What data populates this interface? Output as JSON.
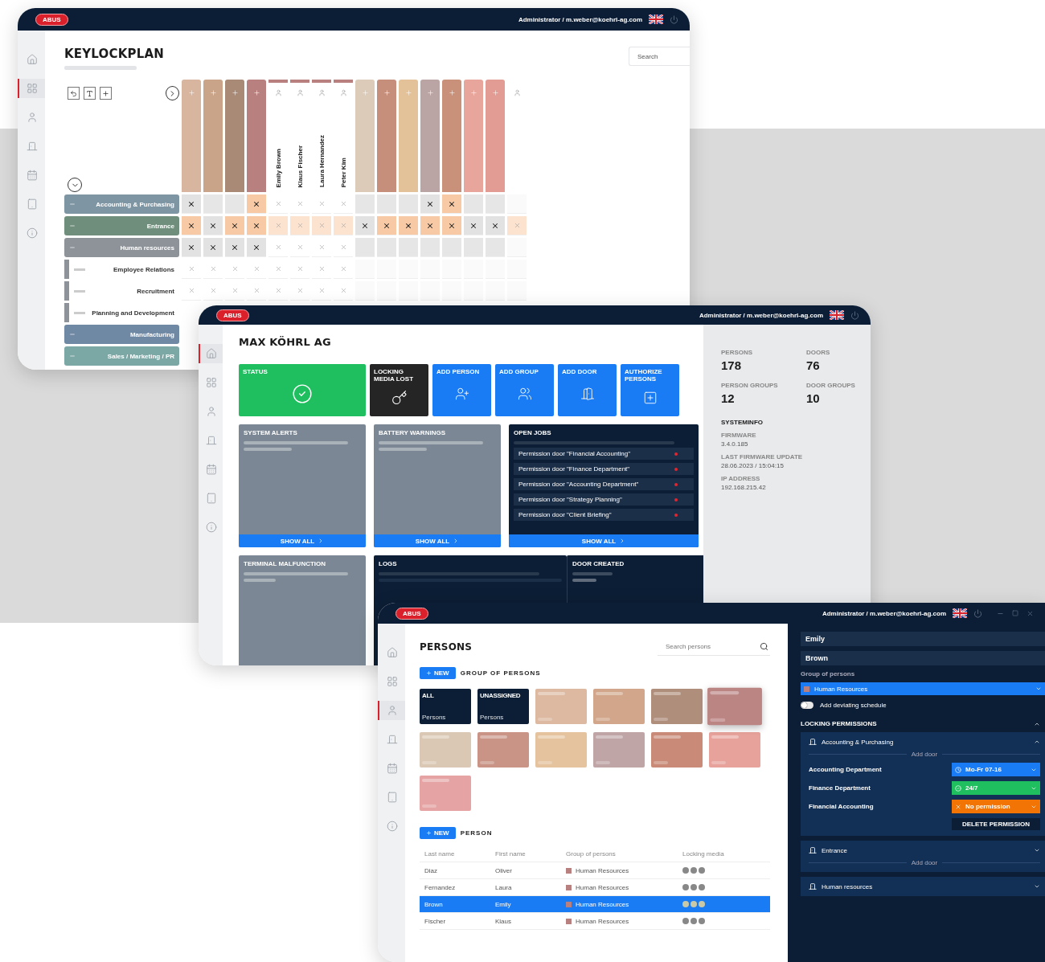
{
  "keylockplan_window": {
    "logo": "ABUS",
    "user": "Administrator / m.weber@koehrl-ag.com",
    "sidebar": [
      {
        "selected": false
      },
      {
        "selected": true
      },
      {
        "selected": false
      },
      {
        "selected": false
      },
      {
        "selected": false
      },
      {
        "selected": false
      },
      {
        "selected": false
      }
    ],
    "title": "KEYLOCKPLAN",
    "search": {
      "placeholder": "Search"
    },
    "columns": [
      {
        "kind": "group",
        "color": "#d8b59f"
      },
      {
        "kind": "group",
        "color": "#c9a488"
      },
      {
        "kind": "group",
        "color": "#a88a76"
      },
      {
        "kind": "group",
        "color": "#b8807f"
      },
      {
        "kind": "person",
        "label": "Emily Brown",
        "color": "#b8807f"
      },
      {
        "kind": "person",
        "label": "Klaus Fischer",
        "color": "#b8807f"
      },
      {
        "kind": "person",
        "label": "Laura Hernandez",
        "color": "#b8807f"
      },
      {
        "kind": "person",
        "label": "Peter Kim",
        "color": "#b8807f"
      },
      {
        "kind": "group",
        "color": "#dccbb8"
      },
      {
        "kind": "group",
        "color": "#c68f7c"
      },
      {
        "kind": "group",
        "color": "#e3c29a"
      },
      {
        "kind": "group",
        "color": "#bba4a4"
      },
      {
        "kind": "group",
        "color": "#c9907a"
      },
      {
        "kind": "group",
        "color": "#e8a59c"
      },
      {
        "kind": "group",
        "color": "#e29c94"
      },
      {
        "kind": "person",
        "color": "#ffffff"
      }
    ],
    "rows": [
      {
        "kind": "group",
        "label": "Accounting & Purchasing",
        "color": "#7e95a3",
        "cells": [
          {
            "crossed": true,
            "strong": true,
            "color": "#e2e2e2"
          },
          {
            "crossed": false,
            "color": "#e6e6e6"
          },
          {
            "crossed": false,
            "color": "#e6e6e6"
          },
          {
            "crossed": true,
            "strong": true,
            "color": "#f7c9a4"
          },
          {
            "crossed": true,
            "strong": false,
            "color": "#ffffff"
          },
          {
            "crossed": true,
            "strong": false,
            "color": "#ffffff"
          },
          {
            "crossed": true,
            "strong": false,
            "color": "#ffffff"
          },
          {
            "crossed": true,
            "strong": false,
            "color": "#ffffff"
          },
          {
            "crossed": false,
            "color": "#e6e6e6"
          },
          {
            "crossed": false,
            "color": "#e6e6e6"
          },
          {
            "crossed": false,
            "color": "#e6e6e6"
          },
          {
            "crossed": true,
            "strong": true,
            "color": "#e2e2e2"
          },
          {
            "crossed": true,
            "strong": true,
            "color": "#f7c9a4"
          },
          {
            "crossed": false,
            "color": "#e6e6e6"
          },
          {
            "crossed": false,
            "color": "#e6e6e6"
          },
          {
            "crossed": false,
            "color": "#fafafa"
          }
        ]
      },
      {
        "kind": "group",
        "label": "Entrance",
        "color": "#6f8f7c",
        "cells": [
          {
            "crossed": true,
            "strong": true,
            "color": "#f7c9a4"
          },
          {
            "crossed": true,
            "strong": true,
            "color": "#e2e2e2"
          },
          {
            "crossed": true,
            "strong": true,
            "color": "#f7c9a4"
          },
          {
            "crossed": true,
            "strong": true,
            "color": "#f7c9a4"
          },
          {
            "crossed": true,
            "strong": false,
            "color": "#fbe3cf"
          },
          {
            "crossed": true,
            "strong": false,
            "color": "#fbe3cf"
          },
          {
            "crossed": true,
            "strong": false,
            "color": "#fbe3cf"
          },
          {
            "crossed": true,
            "strong": false,
            "color": "#fbe3cf"
          },
          {
            "crossed": true,
            "strong": true,
            "color": "#e2e2e2"
          },
          {
            "crossed": true,
            "strong": true,
            "color": "#f7c9a4"
          },
          {
            "crossed": true,
            "strong": true,
            "color": "#f7c9a4"
          },
          {
            "crossed": true,
            "strong": true,
            "color": "#f7c9a4"
          },
          {
            "crossed": true,
            "strong": true,
            "color": "#f7c9a4"
          },
          {
            "crossed": true,
            "strong": true,
            "color": "#e2e2e2"
          },
          {
            "crossed": true,
            "strong": true,
            "color": "#e2e2e2"
          },
          {
            "crossed": true,
            "strong": false,
            "color": "#fbe3cf"
          }
        ]
      },
      {
        "kind": "group",
        "label": "Human resources",
        "color": "#8e9399",
        "cells": [
          {
            "crossed": true,
            "strong": true,
            "color": "#e2e2e2"
          },
          {
            "crossed": true,
            "strong": true,
            "color": "#e2e2e2"
          },
          {
            "crossed": true,
            "strong": true,
            "color": "#e2e2e2"
          },
          {
            "crossed": true,
            "strong": true,
            "color": "#e2e2e2"
          },
          {
            "crossed": true,
            "strong": false,
            "color": "#ffffff"
          },
          {
            "crossed": true,
            "strong": false,
            "color": "#ffffff"
          },
          {
            "crossed": true,
            "strong": false,
            "color": "#ffffff"
          },
          {
            "crossed": true,
            "strong": false,
            "color": "#ffffff"
          },
          {
            "crossed": false,
            "color": "#e6e6e6"
          },
          {
            "crossed": false,
            "color": "#e6e6e6"
          },
          {
            "crossed": false,
            "color": "#e6e6e6"
          },
          {
            "crossed": false,
            "color": "#e6e6e6"
          },
          {
            "crossed": false,
            "color": "#e6e6e6"
          },
          {
            "crossed": false,
            "color": "#e6e6e6"
          },
          {
            "crossed": false,
            "color": "#e6e6e6"
          },
          {
            "crossed": false,
            "color": "#fafafa"
          }
        ]
      },
      {
        "kind": "sub",
        "label": "Employee Relations",
        "cells": [
          {
            "crossed": true,
            "strong": false,
            "color": "#ffffff"
          },
          {
            "crossed": true,
            "strong": false,
            "color": "#ffffff"
          },
          {
            "crossed": true,
            "strong": false,
            "color": "#ffffff"
          },
          {
            "crossed": true,
            "strong": false,
            "color": "#ffffff"
          },
          {
            "crossed": true,
            "strong": false,
            "color": "#ffffff"
          },
          {
            "crossed": true,
            "strong": false,
            "color": "#ffffff"
          },
          {
            "crossed": true,
            "strong": false,
            "color": "#ffffff"
          },
          {
            "crossed": true,
            "strong": false,
            "color": "#ffffff"
          },
          {
            "crossed": false,
            "color": "#fafafa"
          },
          {
            "crossed": false,
            "color": "#fafafa"
          },
          {
            "crossed": false,
            "color": "#fafafa"
          },
          {
            "crossed": false,
            "color": "#fafafa"
          },
          {
            "crossed": false,
            "color": "#fafafa"
          },
          {
            "crossed": false,
            "color": "#fafafa"
          },
          {
            "crossed": false,
            "color": "#fafafa"
          },
          {
            "crossed": false,
            "color": "#fafafa"
          }
        ]
      },
      {
        "kind": "sub",
        "label": "Recruitment",
        "cells": [
          {
            "crossed": true,
            "strong": false,
            "color": "#ffffff"
          },
          {
            "crossed": true,
            "strong": false,
            "color": "#ffffff"
          },
          {
            "crossed": true,
            "strong": false,
            "color": "#ffffff"
          },
          {
            "crossed": true,
            "strong": false,
            "color": "#ffffff"
          },
          {
            "crossed": true,
            "strong": false,
            "color": "#ffffff"
          },
          {
            "crossed": true,
            "strong": false,
            "color": "#ffffff"
          },
          {
            "crossed": true,
            "strong": false,
            "color": "#ffffff"
          },
          {
            "crossed": true,
            "strong": false,
            "color": "#ffffff"
          },
          {
            "crossed": false,
            "color": "#fafafa"
          },
          {
            "crossed": false,
            "color": "#fafafa"
          },
          {
            "crossed": false,
            "color": "#fafafa"
          },
          {
            "crossed": false,
            "color": "#fafafa"
          },
          {
            "crossed": false,
            "color": "#fafafa"
          },
          {
            "crossed": false,
            "color": "#fafafa"
          },
          {
            "crossed": false,
            "color": "#fafafa"
          },
          {
            "crossed": false,
            "color": "#fafafa"
          }
        ]
      },
      {
        "kind": "sub",
        "label": "Planning and Development"
      },
      {
        "kind": "group",
        "label": "Manufacturing",
        "color": "#6f88a3"
      },
      {
        "kind": "group",
        "label": "Sales / Marketing / PR",
        "color": "#7ba7a4"
      }
    ]
  },
  "dashboard_window": {
    "logo": "ABUS",
    "user": "Administrator / m.weber@koehrl-ag.com",
    "sidebar": [
      {
        "selected": true
      },
      {
        "selected": false
      },
      {
        "selected": false
      },
      {
        "selected": false
      },
      {
        "selected": false
      },
      {
        "selected": false
      },
      {
        "selected": false
      }
    ],
    "title": "MAX KÖHRL AG",
    "tiles": [
      {
        "kind": "status",
        "label": "STATUS"
      },
      {
        "kind": "dark",
        "label": "LOCKING MEDIA LOST"
      },
      {
        "kind": "action",
        "label": "ADD PERSON"
      },
      {
        "kind": "action",
        "label": "ADD GROUP"
      },
      {
        "kind": "action",
        "label": "ADD DOOR"
      },
      {
        "kind": "action",
        "label": "AUTHORIZE PERSONS"
      }
    ],
    "panels": [
      {
        "kind": "grey",
        "title": "SYSTEM ALERTS",
        "button": "SHOW ALL"
      },
      {
        "kind": "grey",
        "title": "BATTERY WARNINGS",
        "button": "SHOW ALL"
      },
      {
        "kind": "jobs",
        "title": "OPEN JOBS",
        "button": "SHOW ALL",
        "jobs": [
          "Permission door \"Financial Accounting\"",
          "Permission door \"Finance Department\"",
          "Permission door \"Accounting Department\"",
          "Permission door \"Strategy Planning\"",
          "Permission door \"Client Briefing\""
        ]
      }
    ],
    "bottom": [
      {
        "kind": "grey",
        "title": "TERMINAL MALFUNCTION"
      },
      {
        "kind": "logs",
        "title": "LOGS"
      },
      {
        "kind": "door",
        "title": "DOOR CREATED"
      }
    ],
    "stats": [
      {
        "label": "PERSONS",
        "value": "178"
      },
      {
        "label": "DOORS",
        "value": "76"
      },
      {
        "label": "PERSON GROUPS",
        "value": "12"
      },
      {
        "label": "DOOR GROUPS",
        "value": "10"
      }
    ],
    "sysinfo": {
      "title": "SYSTEMINFO",
      "items": [
        {
          "label": "FIRMWARE",
          "value": "3.4.0.185"
        },
        {
          "label": "LAST FIRMWARE UPDATE",
          "value": "28.06.2023 / 15:04:15"
        },
        {
          "label": "IP ADDRESS",
          "value": "192.168.215.42"
        }
      ]
    }
  },
  "persons_window": {
    "logo": "ABUS",
    "user": "Administrator / m.weber@koehrl-ag.com",
    "sidebar": [
      {
        "selected": false
      },
      {
        "selected": false
      },
      {
        "selected": true
      },
      {
        "selected": false
      },
      {
        "selected": false
      },
      {
        "selected": false
      },
      {
        "selected": false
      }
    ],
    "title": "PERSONS",
    "search": {
      "placeholder": "Search persons"
    },
    "group_section": {
      "button": "NEW",
      "title": "GROUP OF PERSONS"
    },
    "groups": [
      {
        "label": "ALL",
        "sub": "Persons",
        "color": "#0c1e35",
        "selected": false
      },
      {
        "label": "UNASSIGNED",
        "sub": "Persons",
        "color": "#0c1e35",
        "selected": false
      },
      {
        "color": "#dcb9a0",
        "selected": false
      },
      {
        "color": "#d2a68a",
        "selected": false
      },
      {
        "color": "#b08e7c",
        "selected": false
      },
      {
        "color": "#bb8583",
        "selected": true
      },
      {
        "color": "#dbc8b4",
        "selected": false
      },
      {
        "color": "#c99486",
        "selected": false
      },
      {
        "color": "#e5c39f",
        "selected": false
      },
      {
        "color": "#bfa5a6",
        "selected": false
      },
      {
        "color": "#c98b78",
        "selected": false
      },
      {
        "color": "#e6a29b",
        "selected": false
      },
      {
        "color": "#e5a3a3",
        "selected": false
      }
    ],
    "person_section": {
      "button": "NEW",
      "title": "PERSON"
    },
    "columns": [
      "Last name",
      "First name",
      "Group of persons",
      "Locking media"
    ],
    "rows": [
      {
        "last": "Diaz",
        "first": "Oliver",
        "group": "Human Resources",
        "selected": false
      },
      {
        "last": "Fernandez",
        "first": "Laura",
        "group": "Human Resources",
        "selected": false
      },
      {
        "last": "Brown",
        "first": "Emily",
        "group": "Human Resources",
        "selected": true
      },
      {
        "last": "Fischer",
        "first": "Klaus",
        "group": "Human Resources",
        "selected": false
      }
    ],
    "detail": {
      "first": "Emily",
      "last": "Brown",
      "group_label": "Group of persons",
      "group": "Human Resources",
      "toggle": {
        "label": "Add deviating schedule",
        "on": false
      },
      "permissions_title": "LOCKING PERMISSIONS",
      "doors": [
        {
          "label": "Accounting & Purchasing",
          "expanded": true,
          "add": "Add door",
          "delete": "DELETE PERMISSION",
          "rows": [
            {
              "label": "Accounting Department",
              "kind": "schedule",
              "value": "Mo-Fr 07-16"
            },
            {
              "label": "Finance Department",
              "kind": "always",
              "value": "24/7"
            },
            {
              "label": "Financial Accounting",
              "kind": "none",
              "value": "No permission"
            }
          ]
        },
        {
          "label": "Entrance",
          "expanded": false,
          "add": "Add door"
        },
        {
          "label": "Human resources",
          "expanded": false
        }
      ]
    }
  }
}
